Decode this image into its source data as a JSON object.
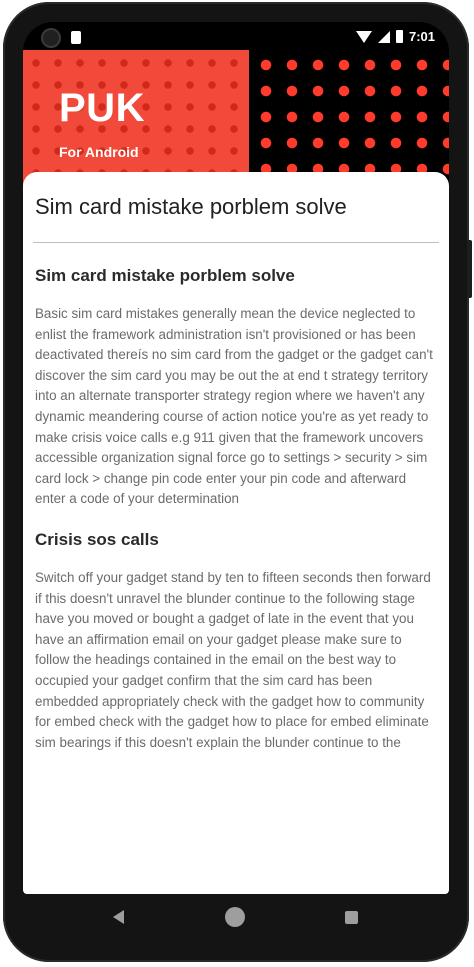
{
  "status_bar": {
    "time": "7:01"
  },
  "banner": {
    "title": "PUK",
    "subtitle": "For Android",
    "colors": {
      "accent": "#f24a3a",
      "dots": "#ff3b2c"
    }
  },
  "article": {
    "title": "Sim card mistake porblem solve",
    "sections": [
      {
        "heading": "Sim card mistake porblem solve",
        "body": "Basic sim card mistakes generally mean the device neglected to enlist the framework administration isn't provisioned or has been deactivated thereís no sim card from the gadget or the gadget can't discover the sim card you may be out the at end t strategy territory into an alternate transporter strategy region where we haven't any dynamic meandering course of action notice you're as yet ready to make crisis voice calls e.g 911 given that the framework uncovers accessible organization signal force go to settings > security > sim card lock > change pin code enter your pin code and afterward enter a code of your determination"
      },
      {
        "heading": "Crisis sos calls",
        "body": "Switch off your gadget stand by ten to fifteen seconds then forward if this doesn't unravel the blunder continue to the following stage have you moved or bought a gadget of late in the event that you have an affirmation email on your gadget please make sure to follow the headings contained in the email on the best way to occupied your gadget confirm that the sim card has been embedded appropriately check with the gadget how to community for embed check with the gadget how to place for embed eliminate sim bearings if this doesn't explain the blunder continue to the"
      }
    ]
  },
  "nav": {
    "icons": [
      "back-icon",
      "home-icon",
      "recent-apps-icon"
    ]
  }
}
